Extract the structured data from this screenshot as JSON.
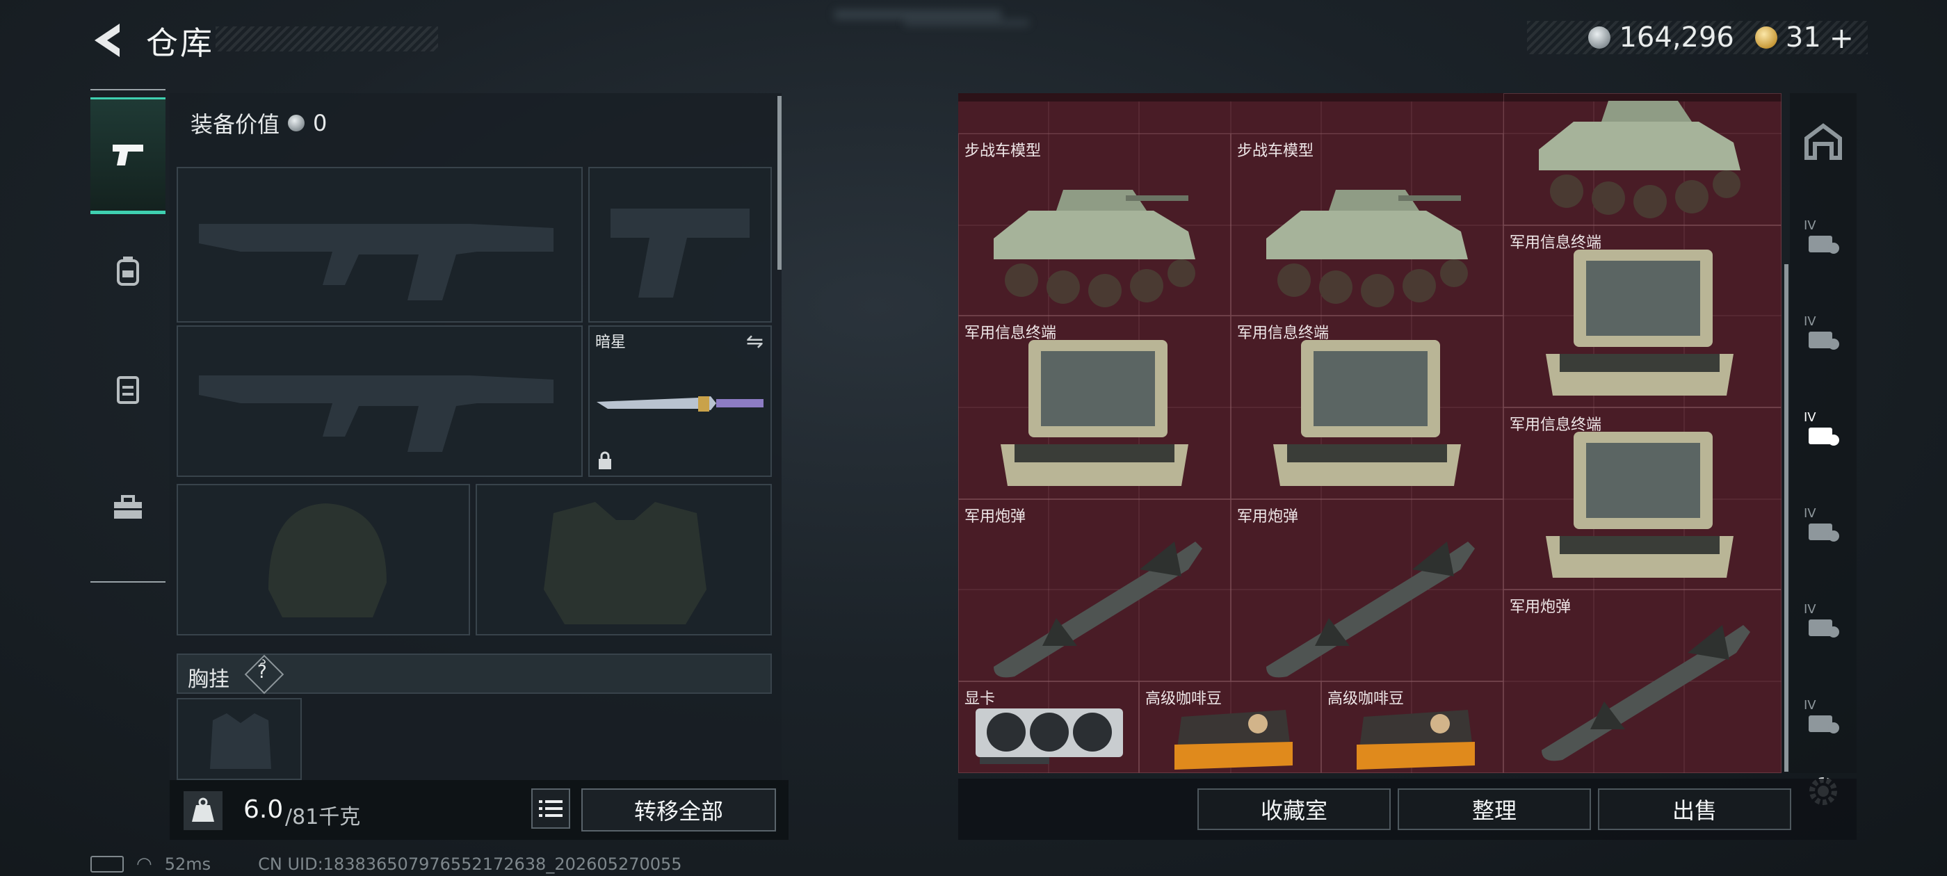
{
  "header": {
    "title": "仓库",
    "silver_amount": "164,296",
    "gold_amount": "31"
  },
  "loadout": {
    "equip_value_label": "装备价值",
    "equip_value": "0",
    "melee_name": "暗星",
    "chest_rig_label": "胸挂",
    "chest_rig_help": "?",
    "weight_current": "6.0",
    "weight_max": "/81千克",
    "transfer_all_label": "转移全部"
  },
  "stash": {
    "cells": [
      {
        "label": "步战车模型",
        "icon": "ifv-model"
      },
      {
        "label": "步战车模型",
        "icon": "ifv-model"
      },
      {
        "label": "",
        "icon": "ifv-model"
      },
      {
        "label": "军用信息终端",
        "icon": "rugged-terminal"
      },
      {
        "label": "军用信息终端",
        "icon": "rugged-terminal"
      },
      {
        "label": "军用信息终端",
        "icon": "rugged-terminal"
      },
      {
        "label": "军用信息终端",
        "icon": "rugged-terminal"
      },
      {
        "label": "军用炮弹",
        "icon": "artillery-shell"
      },
      {
        "label": "军用炮弹",
        "icon": "artillery-shell"
      },
      {
        "label": "军用炮弹",
        "icon": "artillery-shell"
      },
      {
        "label": "显卡",
        "icon": "graphics-card"
      },
      {
        "label": "高级咖啡豆",
        "icon": "coffee-beans"
      },
      {
        "label": "高级咖啡豆",
        "icon": "coffee-beans"
      }
    ],
    "tab_badge": "IV"
  },
  "actions": {
    "collection_label": "收藏室",
    "organize_label": "整理",
    "sell_label": "出售"
  },
  "status": {
    "ping": "52ms",
    "uid": "CN UID:1838365079765521726​38_202605270055"
  },
  "colors": {
    "stash_bg": "#491c26",
    "accent_teal": "#3fd0b0"
  }
}
